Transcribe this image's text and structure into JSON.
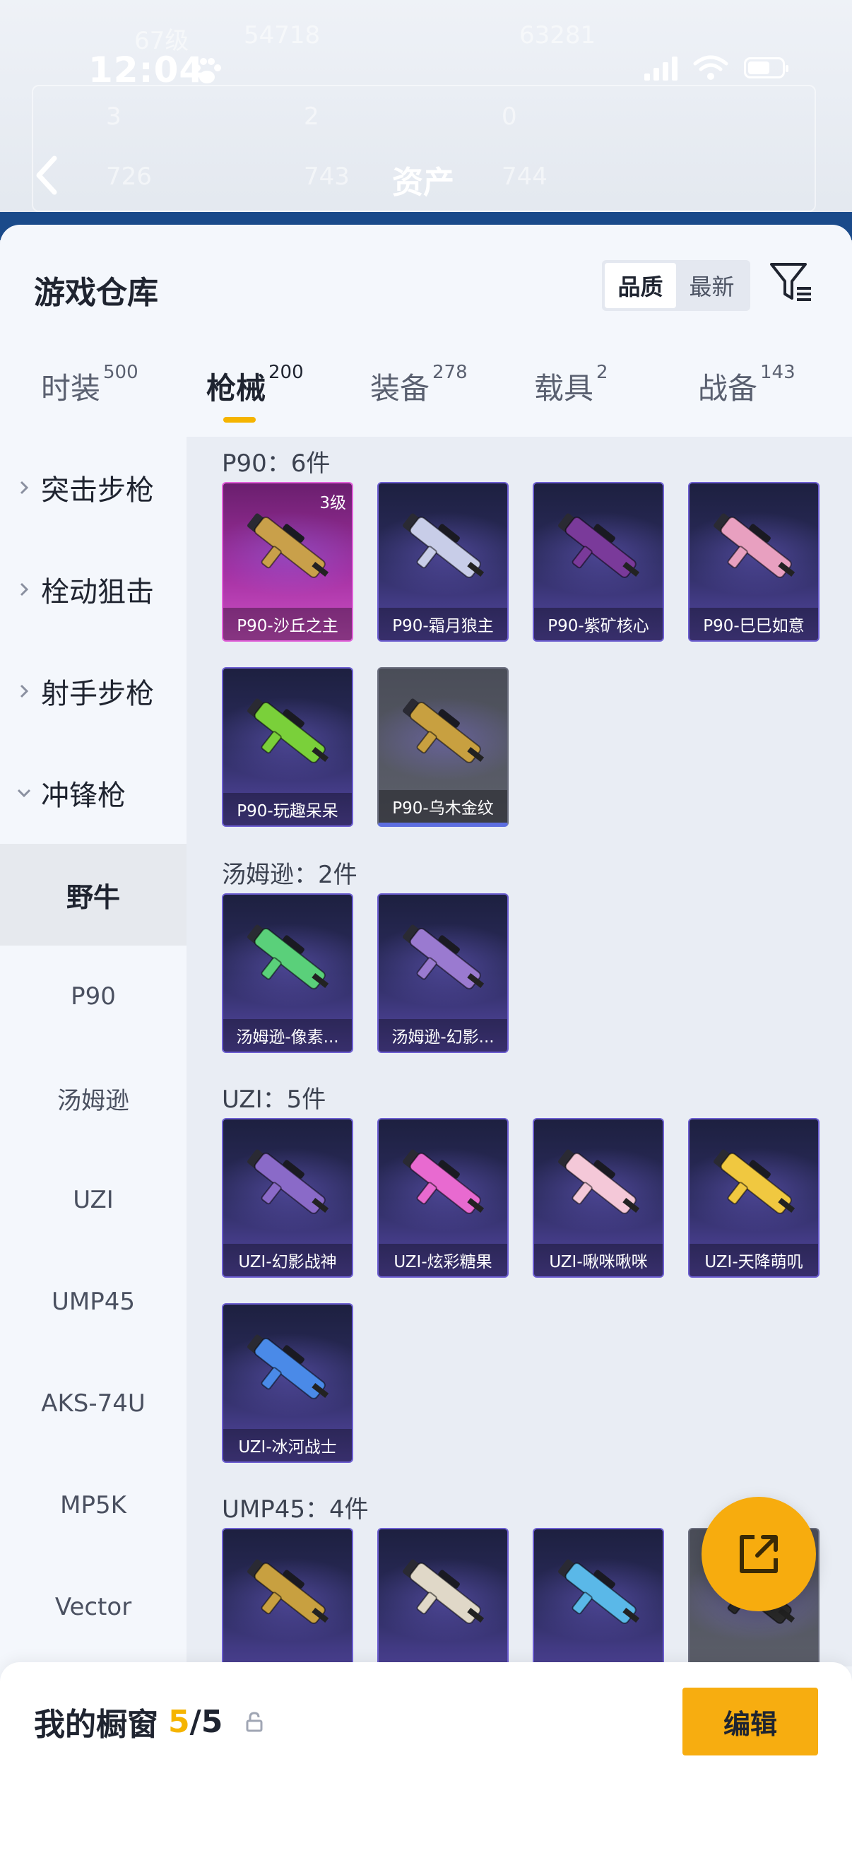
{
  "status_bar": {
    "time": "12:04"
  },
  "background_page": {
    "title": "资产",
    "faint_texts": [
      "67级",
      "54718",
      "63281",
      "3",
      "2",
      "0",
      "726",
      "743",
      "744"
    ]
  },
  "sheet": {
    "title": "游戏仓库",
    "sort": {
      "options": [
        "品质",
        "最新"
      ],
      "selected": "品质"
    },
    "tabs": [
      {
        "label": "时装",
        "count": "500"
      },
      {
        "label": "枪械",
        "count": "200"
      },
      {
        "label": "装备",
        "count": "278"
      },
      {
        "label": "载具",
        "count": "2"
      },
      {
        "label": "战备",
        "count": "143"
      }
    ],
    "active_tab": "枪械"
  },
  "sidebar": {
    "categories": [
      "突击步枪",
      "栓动狙击",
      "射手步枪",
      "冲锋枪"
    ],
    "subitems": [
      "野牛",
      "P90",
      "汤姆逊",
      "UZI",
      "UMP45",
      "AKS-74U",
      "MP5K",
      "Vector"
    ],
    "active_subitem": "野牛"
  },
  "sections": [
    {
      "title": "P90：6件",
      "items": [
        {
          "name": "P90-沙丘之主",
          "level": "3级",
          "rarity": "legendary",
          "color": "#c9a04a"
        },
        {
          "name": "P90-霜月狼主",
          "rarity": "epic",
          "color": "#c8cde8"
        },
        {
          "name": "P90-紫矿核心",
          "rarity": "epic",
          "color": "#7a3a9a"
        },
        {
          "name": "P90-巳巳如意",
          "rarity": "epic",
          "color": "#e8a0c0"
        },
        {
          "name": "P90-玩趣呆呆",
          "rarity": "epic",
          "color": "#7ad03a"
        },
        {
          "name": "P90-乌木金纹",
          "rarity": "common",
          "color": "#c8a040"
        }
      ]
    },
    {
      "title": "汤姆逊：2件",
      "items": [
        {
          "name": "汤姆逊-像素...",
          "rarity": "epic",
          "color": "#5ad07a"
        },
        {
          "name": "汤姆逊-幻影...",
          "rarity": "epic",
          "color": "#9a7ad0"
        }
      ]
    },
    {
      "title": "UZI：5件",
      "items": [
        {
          "name": "UZI-幻影战神",
          "rarity": "epic",
          "color": "#8a6ac8"
        },
        {
          "name": "UZI-炫彩糖果",
          "rarity": "epic",
          "color": "#e86ad0"
        },
        {
          "name": "UZI-啾咪啾咪",
          "rarity": "epic",
          "color": "#f4c8d8"
        },
        {
          "name": "UZI-天降萌叽",
          "rarity": "epic",
          "color": "#f0c840"
        },
        {
          "name": "UZI-冰河战士",
          "rarity": "epic",
          "color": "#4a8ae8"
        }
      ]
    },
    {
      "title": "UMP45：4件",
      "items": [
        {
          "name": "",
          "rarity": "epic",
          "color": "#c8a040"
        },
        {
          "name": "",
          "rarity": "epic",
          "color": "#e0d8c8"
        },
        {
          "name": "",
          "rarity": "epic",
          "color": "#5ab8e8"
        },
        {
          "name": "",
          "rarity": "common",
          "color": "#2a2a2a"
        }
      ]
    }
  ],
  "my_window": {
    "label": "我的橱窗",
    "count": "5",
    "total": "/5"
  },
  "edit_button": "编辑",
  "icons": [
    "paw-icon",
    "signal-icon",
    "wifi-icon",
    "battery-icon",
    "back-icon",
    "filter-icon",
    "chevron-right-icon",
    "chevron-down-icon",
    "share-icon",
    "lock-icon"
  ]
}
